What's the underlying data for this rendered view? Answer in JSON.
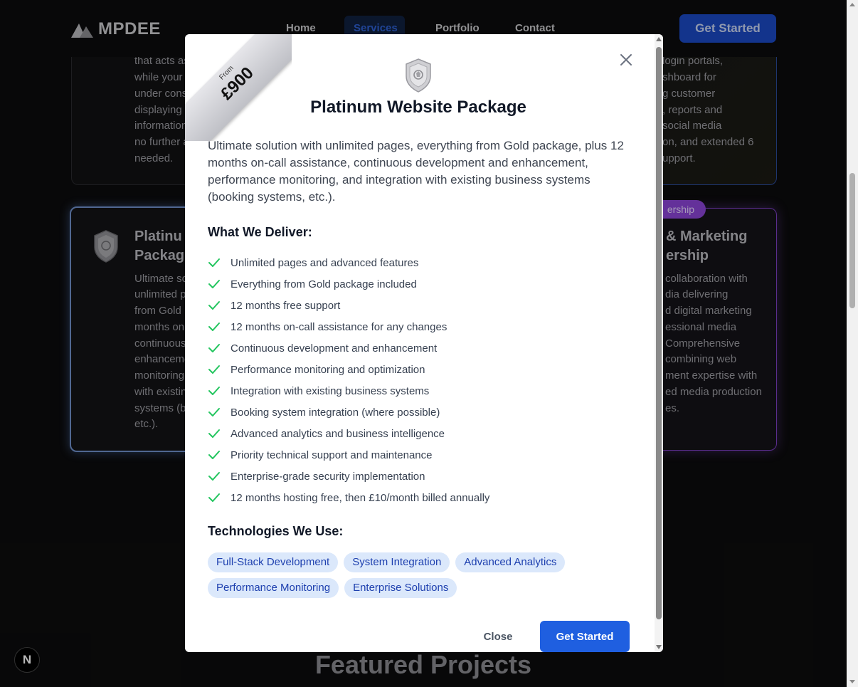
{
  "header": {
    "logo_text": "MPDEE",
    "nav": [
      "Home",
      "Services",
      "Portfolio",
      "Contact"
    ],
    "active_nav": "Services",
    "cta_label": "Get Started"
  },
  "background": {
    "card_top_left_lines": [
      "that acts as",
      "while your",
      "under cons",
      "displaying",
      "information",
      "no further a",
      "needed."
    ],
    "card_top_right_lines": [
      "login portals,",
      "shboard for",
      "g customer",
      ", reports and",
      "social media",
      "on, and extended 6",
      "upport."
    ],
    "platinum_card_title": [
      "Platinu",
      "Packag"
    ],
    "platinum_card_lines": [
      "Ultimate so",
      "unlimited p",
      "from Gold p",
      "months on",
      "continuous",
      "enhanceme",
      "monitoring",
      "with existin",
      "systems (b",
      "etc.)."
    ],
    "partner_pill": "ership",
    "marketing_title": [
      "& Marketing",
      "ership"
    ],
    "marketing_lines": [
      "collaboration with",
      "dia delivering",
      "d digital marketing",
      "essional media",
      "Comprehensive",
      "combining web",
      "ment expertise with",
      "ed media production",
      "es."
    ],
    "featured_heading": "Featured Projects",
    "next_badge": "N"
  },
  "modal": {
    "ribbon_from": "From",
    "ribbon_price": "£900",
    "title": "Platinum Website Package",
    "description": "Ultimate solution with unlimited pages, everything from Gold package, plus 12 months on-call assistance, continuous development and enhancement, performance monitoring, and integration with existing business systems (booking systems, etc.).",
    "deliver_heading": "What We Deliver:",
    "features": [
      "Unlimited pages and advanced features",
      "Everything from Gold package included",
      "12 months free support",
      "12 months on-call assistance for any changes",
      "Continuous development and enhancement",
      "Performance monitoring and optimization",
      "Integration with existing business systems",
      "Booking system integration (where possible)",
      "Advanced analytics and business intelligence",
      "Priority technical support and maintenance",
      "Enterprise-grade security implementation",
      "12 months hosting free, then £10/month billed annually"
    ],
    "tech_heading": "Technologies We Use:",
    "technologies": [
      "Full-Stack Development",
      "System Integration",
      "Advanced Analytics",
      "Performance Monitoring",
      "Enterprise Solutions"
    ],
    "close_label": "Close",
    "cta_label": "Get Started"
  },
  "colors": {
    "accent": "#1f5fe0",
    "check": "#22c55e",
    "tag_bg": "#dbe8fb",
    "tag_text": "#1e40af"
  }
}
